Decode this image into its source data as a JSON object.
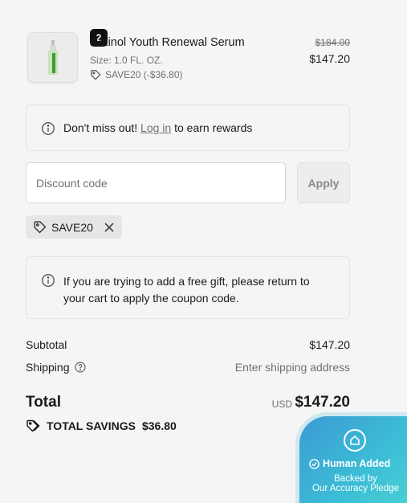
{
  "product": {
    "name": "Retinol Youth Renewal Serum",
    "size": "Size: 1.0 FL. OZ.",
    "discount": "SAVE20 (-$36.80)",
    "quantity": "2",
    "original_price": "$184.00",
    "price": "$147.20"
  },
  "rewards_notice": {
    "prefix": "Don't miss out!",
    "link": "Log in",
    "suffix": "to earn rewards"
  },
  "discount": {
    "placeholder": "Discount code",
    "apply_label": "Apply",
    "applied_code": "SAVE20"
  },
  "gift_notice": "If you are trying to add a free gift, please return to your cart to apply the coupon code.",
  "summary": {
    "subtotal_label": "Subtotal",
    "subtotal_value": "$147.20",
    "shipping_label": "Shipping",
    "shipping_value": "Enter shipping address",
    "total_label": "Total",
    "currency": "USD",
    "total_value": "$147.20",
    "savings_label": "TOTAL SAVINGS",
    "savings_value": "$36.80"
  },
  "badge": {
    "title": "Human Added",
    "line1": "Backed by",
    "line2": "Our Accuracy Pledge"
  },
  "icons": [
    "tag-icon",
    "info-icon",
    "close-icon",
    "help-icon",
    "home-icon",
    "check-circle-icon"
  ]
}
